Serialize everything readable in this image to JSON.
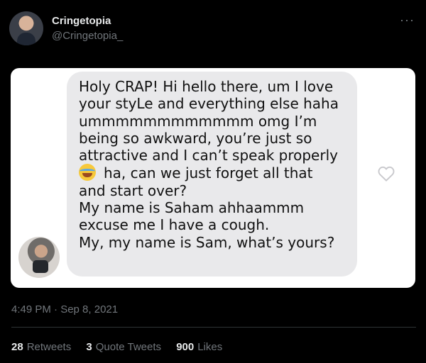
{
  "tweet": {
    "author_name": "Cringetopia",
    "author_handle": "@Cringetopia_",
    "more_label": "···",
    "timestamp": "4:49 PM · Sep 8, 2021",
    "stats": {
      "retweets_count": "28",
      "retweets_label": "Retweets",
      "quotes_count": "3",
      "quotes_label": "Quote Tweets",
      "likes_count": "900",
      "likes_label": "Likes"
    }
  },
  "message": {
    "lines": [
      "Holy CRAP! Hi hello there, um I love",
      "your styLe and everything else haha",
      "ummmmmmmmmmmm omg I’m",
      "being so awkward, you’re just so",
      "attractive and I can’t speak properly",
      "ha, can we just forget all that",
      "and start over?",
      "My name is Saham ahhaammm",
      "excuse me I have a cough.",
      "My, my name is Sam, what’s yours?"
    ],
    "emoji_name": "face-with-tears-of-joy-icon"
  },
  "colors": {
    "background": "#000000",
    "bubble": "#e9e9eb",
    "muted_text": "#71767b"
  }
}
